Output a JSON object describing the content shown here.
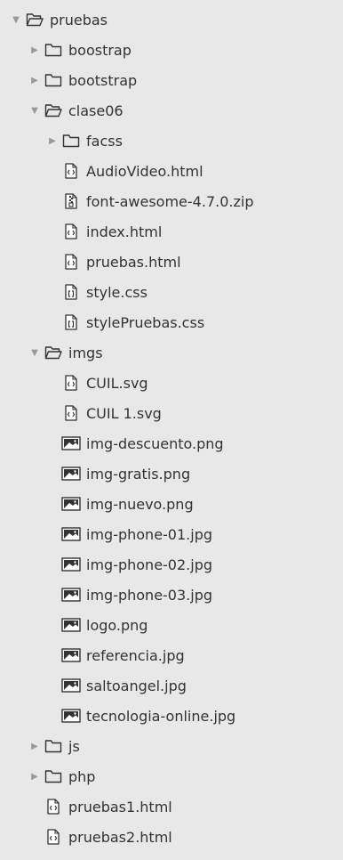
{
  "tree": [
    {
      "name": "pruebas",
      "type": "folder",
      "depth": 0,
      "expanded": true,
      "icon": "folder-open-icon"
    },
    {
      "name": "boostrap",
      "type": "folder",
      "depth": 1,
      "expanded": false,
      "icon": "folder-icon"
    },
    {
      "name": "bootstrap",
      "type": "folder",
      "depth": 1,
      "expanded": false,
      "icon": "folder-icon"
    },
    {
      "name": "clase06",
      "type": "folder",
      "depth": 1,
      "expanded": true,
      "icon": "folder-open-icon"
    },
    {
      "name": "facss",
      "type": "folder",
      "depth": 2,
      "expanded": false,
      "icon": "folder-icon"
    },
    {
      "name": "AudioVideo.html",
      "type": "file",
      "depth": 2,
      "icon": "html-file-icon"
    },
    {
      "name": "font-awesome-4.7.0.zip",
      "type": "file",
      "depth": 2,
      "icon": "zip-file-icon"
    },
    {
      "name": "index.html",
      "type": "file",
      "depth": 2,
      "icon": "html-file-icon"
    },
    {
      "name": "pruebas.html",
      "type": "file",
      "depth": 2,
      "icon": "html-file-icon"
    },
    {
      "name": "style.css",
      "type": "file",
      "depth": 2,
      "icon": "css-file-icon"
    },
    {
      "name": "stylePruebas.css",
      "type": "file",
      "depth": 2,
      "icon": "css-file-icon"
    },
    {
      "name": "imgs",
      "type": "folder",
      "depth": 1,
      "expanded": true,
      "icon": "folder-open-icon"
    },
    {
      "name": "CUIL.svg",
      "type": "file",
      "depth": 2,
      "icon": "svg-file-icon"
    },
    {
      "name": "CUIL 1.svg",
      "type": "file",
      "depth": 2,
      "icon": "svg-file-icon"
    },
    {
      "name": "img-descuento.png",
      "type": "file",
      "depth": 2,
      "icon": "image-file-icon"
    },
    {
      "name": "img-gratis.png",
      "type": "file",
      "depth": 2,
      "icon": "image-file-icon"
    },
    {
      "name": "img-nuevo.png",
      "type": "file",
      "depth": 2,
      "icon": "image-file-icon"
    },
    {
      "name": "img-phone-01.jpg",
      "type": "file",
      "depth": 2,
      "icon": "image-file-icon"
    },
    {
      "name": "img-phone-02.jpg",
      "type": "file",
      "depth": 2,
      "icon": "image-file-icon"
    },
    {
      "name": "img-phone-03.jpg",
      "type": "file",
      "depth": 2,
      "icon": "image-file-icon"
    },
    {
      "name": "logo.png",
      "type": "file",
      "depth": 2,
      "icon": "image-file-icon"
    },
    {
      "name": "referencia.jpg",
      "type": "file",
      "depth": 2,
      "icon": "image-file-icon"
    },
    {
      "name": "saltoangel.jpg",
      "type": "file",
      "depth": 2,
      "icon": "image-file-icon"
    },
    {
      "name": "tecnologia-online.jpg",
      "type": "file",
      "depth": 2,
      "icon": "image-file-icon"
    },
    {
      "name": "js",
      "type": "folder",
      "depth": 1,
      "expanded": false,
      "icon": "folder-icon"
    },
    {
      "name": "php",
      "type": "folder",
      "depth": 1,
      "expanded": false,
      "icon": "folder-icon"
    },
    {
      "name": "pruebas1.html",
      "type": "file",
      "depth": 1,
      "icon": "html-file-icon"
    },
    {
      "name": "pruebas2.html",
      "type": "file",
      "depth": 1,
      "icon": "html-file-icon"
    }
  ],
  "colors": {
    "background": "#e8e8e8",
    "text": "#333333",
    "arrow": "#9a9a9a",
    "icon_stroke": "#333333"
  }
}
